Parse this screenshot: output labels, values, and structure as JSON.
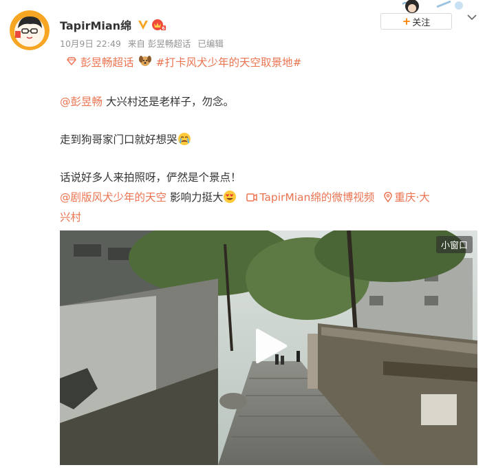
{
  "user": {
    "name": "TapirMian绵",
    "meta": {
      "date": "10月9日 22:49",
      "source": "来自 彭昱畅超话",
      "edited": "已编辑"
    },
    "follow_label": "关注"
  },
  "topics": {
    "supertopic": "彭昱畅超话",
    "hashtag": "#打卡风犬少年的天空取景地#"
  },
  "content": {
    "line1_mention": "@彭昱畅",
    "line1_text": " 大兴村还是老样子，勿念。",
    "line2_text": "走到狗哥家门口就好想哭",
    "line3_text": "话说好多人来拍照呀，俨然是个景点！",
    "line4_mention": "@剧版风犬少年的天空",
    "line4_text": " 影响力挺大",
    "video_link": "TapirMian绵的微博视频",
    "location_part1": "重庆·大",
    "location_part2": "兴村"
  },
  "video": {
    "mini_window_label": "小窗口"
  },
  "colors": {
    "link": "#eb7350",
    "follow_plus": "#ff8200",
    "meta_gray": "#939393"
  },
  "icons": [
    "verified-v-icon",
    "vip-badge-icon",
    "diamond-topic-icon",
    "dog-emoji",
    "crying-emoji",
    "heart-eyes-emoji",
    "video-camera-icon",
    "location-pin-icon",
    "play-icon",
    "chevron-down-icon"
  ]
}
